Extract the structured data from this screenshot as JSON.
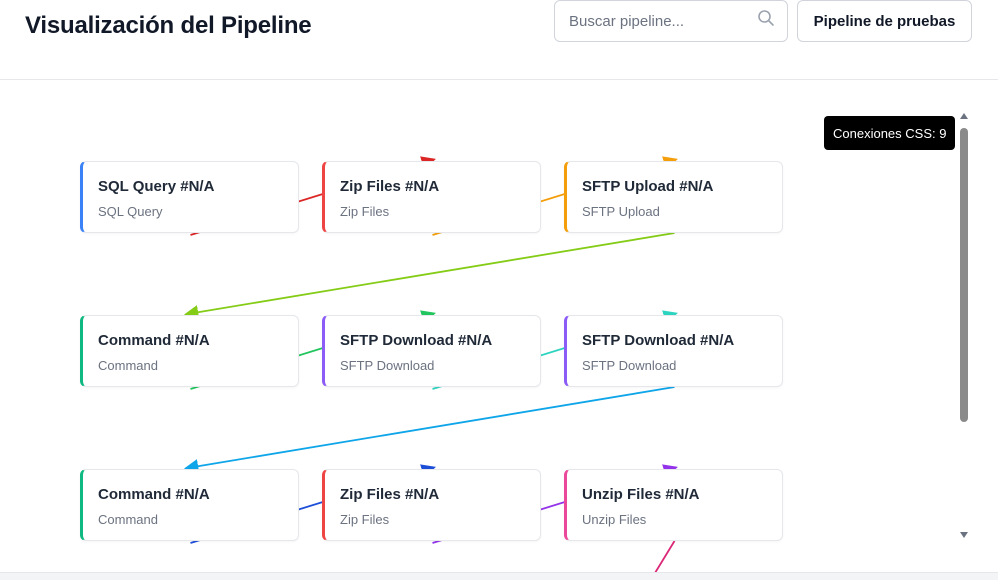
{
  "header": {
    "title": "Visualización del Pipeline",
    "search_placeholder": "Buscar pipeline...",
    "search_icon": "search-icon",
    "test_button_label": "Pipeline de pruebas"
  },
  "tooltip": {
    "text": "Conexiones CSS: 9"
  },
  "nodes": [
    {
      "title": "SQL Query #N/A",
      "subtitle": "SQL Query",
      "accent": "#3b82f6"
    },
    {
      "title": "Zip Files #N/A",
      "subtitle": "Zip Files",
      "accent": "#ef4444"
    },
    {
      "title": "SFTP Upload #N/A",
      "subtitle": "SFTP Upload",
      "accent": "#f59e0b"
    },
    {
      "title": "Command #N/A",
      "subtitle": "Command",
      "accent": "#10b981"
    },
    {
      "title": "SFTP Download #N/A",
      "subtitle": "SFTP Download",
      "accent": "#8b5cf6"
    },
    {
      "title": "SFTP Download #N/A",
      "subtitle": "SFTP Download",
      "accent": "#8b5cf6"
    },
    {
      "title": "Command #N/A",
      "subtitle": "Command",
      "accent": "#10b981"
    },
    {
      "title": "Zip Files #N/A",
      "subtitle": "Zip Files",
      "accent": "#ef4444"
    },
    {
      "title": "Unzip Files #N/A",
      "subtitle": "Unzip Files",
      "accent": "#ec4899"
    }
  ],
  "connections": [
    {
      "from": 0,
      "to": 1,
      "color": "#dc2626"
    },
    {
      "from": 1,
      "to": 2,
      "color": "#f59e0b"
    },
    {
      "from": 2,
      "to": 3,
      "color": "#84cc16"
    },
    {
      "from": 3,
      "to": 4,
      "color": "#22c55e"
    },
    {
      "from": 4,
      "to": 5,
      "color": "#2dd4bf"
    },
    {
      "from": 5,
      "to": 6,
      "color": "#0ea5e9"
    },
    {
      "from": 6,
      "to": 7,
      "color": "#1d4ed8"
    },
    {
      "from": 7,
      "to": 8,
      "color": "#9333ea"
    },
    {
      "from": 8,
      "to": 9,
      "color": "#db2777"
    }
  ]
}
